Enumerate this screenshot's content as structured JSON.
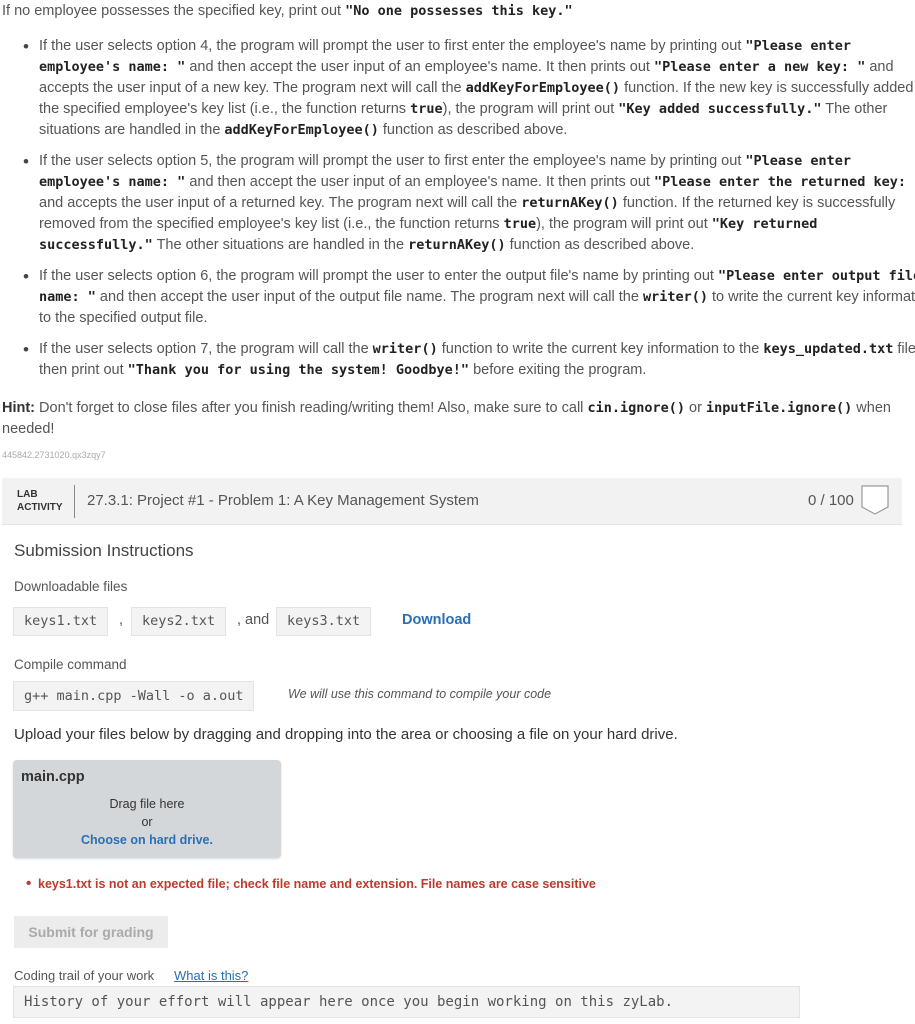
{
  "intro": {
    "prefix": "If no employee possesses the specified key, print out ",
    "code": "\"No one possesses this key.\""
  },
  "bullets": {
    "b4": {
      "t1": "If the user selects option 4, the program will prompt the user to first enter the employee's name by printing out ",
      "c1": "\"Please enter employee's name: \"",
      "t2": " and then accept the user input of an employee's name. It then prints out ",
      "c2": "\"Please enter a new key: \"",
      "t3": " and accepts the user input of a new key. The program next will call the ",
      "c3": "addKeyForEmployee()",
      "t4": " function. If the new key is successfully added to the specified employee's key list (i.e., the function returns ",
      "c4": "true",
      "t5": "), the program will print out ",
      "c5": "\"Key added successfully.\"",
      "t6": " The other situations are handled in the ",
      "c6": "addKeyForEmployee()",
      "t7": " function as described above."
    },
    "b5": {
      "t1": "If the user selects option 5, the program will prompt the user to first enter the employee's name by printing out ",
      "c1": "\"Please enter employee's name: \"",
      "t2": " and then accept the user input of an employee's name. It then prints out ",
      "c2": "\"Please enter the returned key: \"",
      "t3": " and accepts the user input of a returned key. The program next will call the ",
      "c3": "returnAKey()",
      "t4": " function. If the returned key is successfully removed from the specified employee's key list (i.e., the function returns ",
      "c4": "true",
      "t5": "), the program will print out ",
      "c5": "\"Key returned successfully.\"",
      "t6": " The other situations are handled in the ",
      "c6": "returnAKey()",
      "t7": " function as described above."
    },
    "b6": {
      "t1": "If the user selects option 6, the program will prompt the user to enter the output file's name by printing out ",
      "c1": "\"Please enter output file name: \"",
      "t2": " and then accept the user input of the output file name. The program next will call the ",
      "c2": "writer()",
      "t3": " to write the current key information to the specified output file."
    },
    "b7": {
      "t1": "If the user selects option 7, the program will call the ",
      "c1": "writer()",
      "t2": " function to write the current key information to the ",
      "c2": "keys_updated.txt",
      "t3": " file then print out ",
      "c3": "\"Thank you for using the system! Goodbye!\"",
      "t4": " before exiting the program."
    }
  },
  "hint": {
    "label": "Hint:",
    "t1": " Don't forget to close files after you finish reading/writing them! Also, make sure to call ",
    "c1": "cin.ignore()",
    "t2": " or ",
    "c2": "inputFile.ignore()",
    "t3": " when needed!"
  },
  "code_id": "445842.2731020.qx3zqy7",
  "lab": {
    "label_line1": "LAB",
    "label_line2": "ACTIVITY",
    "title": "27.3.1: Project #1 - Problem 1: A Key Management System",
    "score": "0 / 100"
  },
  "submission": {
    "title": "Submission Instructions",
    "downloadable_label": "Downloadable files",
    "files": [
      "keys1.txt",
      "keys2.txt",
      "keys3.txt"
    ],
    "sep_comma": ",",
    "sep_and": ", and",
    "download_label": "Download",
    "compile_label": "Compile command",
    "compile_command": "g++ main.cpp -Wall -o a.out",
    "compile_note": "We will use this command to compile your code",
    "upload_instructions": "Upload your files below by dragging and dropping into the area or choosing a file on your hard drive.",
    "dropzone": {
      "filename": "main.cpp",
      "drag": "Drag file here",
      "or": "or",
      "choose": "Choose on hard drive."
    },
    "error": "keys1.txt is not an expected file; check file name and extension. File names are case sensitive",
    "submit_label": "Submit for grading",
    "trail_label": "Coding trail of your work",
    "trail_link": "What is this?",
    "history": "History of your effort will appear here once you begin working on this zyLab."
  }
}
